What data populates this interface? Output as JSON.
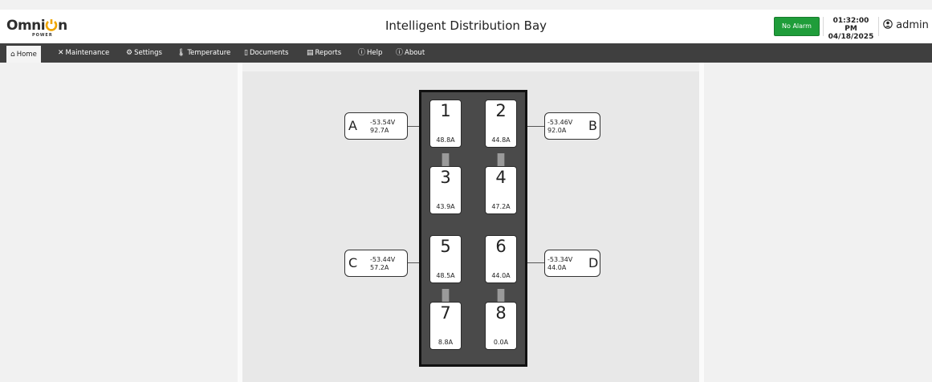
{
  "header": {
    "logo_text": "Omni",
    "logo_text2": "n",
    "logo_sub": "POWER",
    "title": "Intelligent Distribution Bay",
    "alarm_label": "No Alarm",
    "time": "01:32:00 PM",
    "date": "04/18/2025",
    "user": "admin"
  },
  "nav": {
    "home": "Home",
    "maintenance": "Maintenance",
    "settings": "Settings",
    "temperature": "Temperature",
    "documents": "Documents",
    "reports": "Reports",
    "help": "Help",
    "about": "About"
  },
  "buses": {
    "a": {
      "label": "A",
      "voltage": "-53.54V",
      "current": "92.7A"
    },
    "b": {
      "label": "B",
      "voltage": "-53.46V",
      "current": "92.0A"
    },
    "c": {
      "label": "C",
      "voltage": "-53.44V",
      "current": "57.2A"
    },
    "d": {
      "label": "D",
      "voltage": "-53.34V",
      "current": "44.0A"
    }
  },
  "breakers": [
    {
      "number": "1",
      "current": "48.8A"
    },
    {
      "number": "2",
      "current": "44.8A"
    },
    {
      "number": "3",
      "current": "43.9A"
    },
    {
      "number": "4",
      "current": "47.2A"
    },
    {
      "number": "5",
      "current": "48.5A"
    },
    {
      "number": "6",
      "current": "44.0A"
    },
    {
      "number": "7",
      "current": "8.8A"
    },
    {
      "number": "8",
      "current": "0.0A"
    }
  ],
  "colors": {
    "alarm_ok": "#1f9d3a",
    "navbar": "#3f3f3f",
    "bay": "#4a4a4a",
    "logo_accent": "#f0a500"
  },
  "icons": {
    "home": "home-icon",
    "maintenance": "tools-icon",
    "settings": "gear-icon",
    "temperature": "thermometer-icon",
    "documents": "document-icon",
    "reports": "report-icon",
    "help": "help-icon",
    "about": "info-icon",
    "user": "user-icon"
  }
}
